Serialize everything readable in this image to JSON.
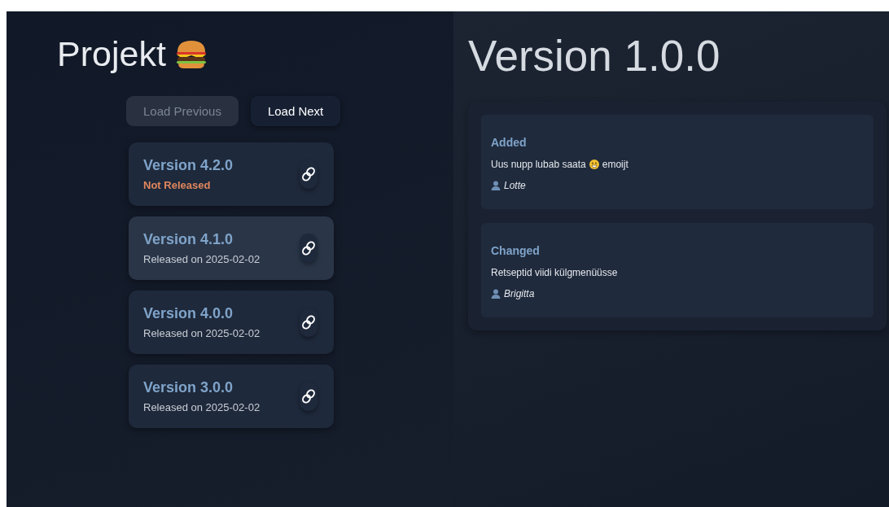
{
  "sidebar": {
    "title": "Projekt",
    "buttons": [
      {
        "label": "Load Previous",
        "disabled": true
      },
      {
        "label": "Load Next",
        "disabled": false
      }
    ],
    "versions": [
      {
        "name": "Version 4.2.0",
        "status": "Not Released",
        "released": false,
        "selected": false
      },
      {
        "name": "Version 4.1.0",
        "status": "Released on 2025-02-02",
        "released": true,
        "selected": true
      },
      {
        "name": "Version 4.0.0",
        "status": "Released on 2025-02-02",
        "released": true,
        "selected": false
      },
      {
        "name": "Version 3.0.0",
        "status": "Released on 2025-02-02",
        "released": true,
        "selected": false
      }
    ]
  },
  "detail": {
    "title": "Version 1.0.0",
    "sections": [
      {
        "heading": "Added",
        "text": "Uus nupp lubab saata",
        "text_after": "emoijt",
        "author": "Lotte"
      },
      {
        "heading": "Changed",
        "text": "Retseptid viidi külgmenüüsse",
        "author": "Brigitta"
      }
    ]
  }
}
